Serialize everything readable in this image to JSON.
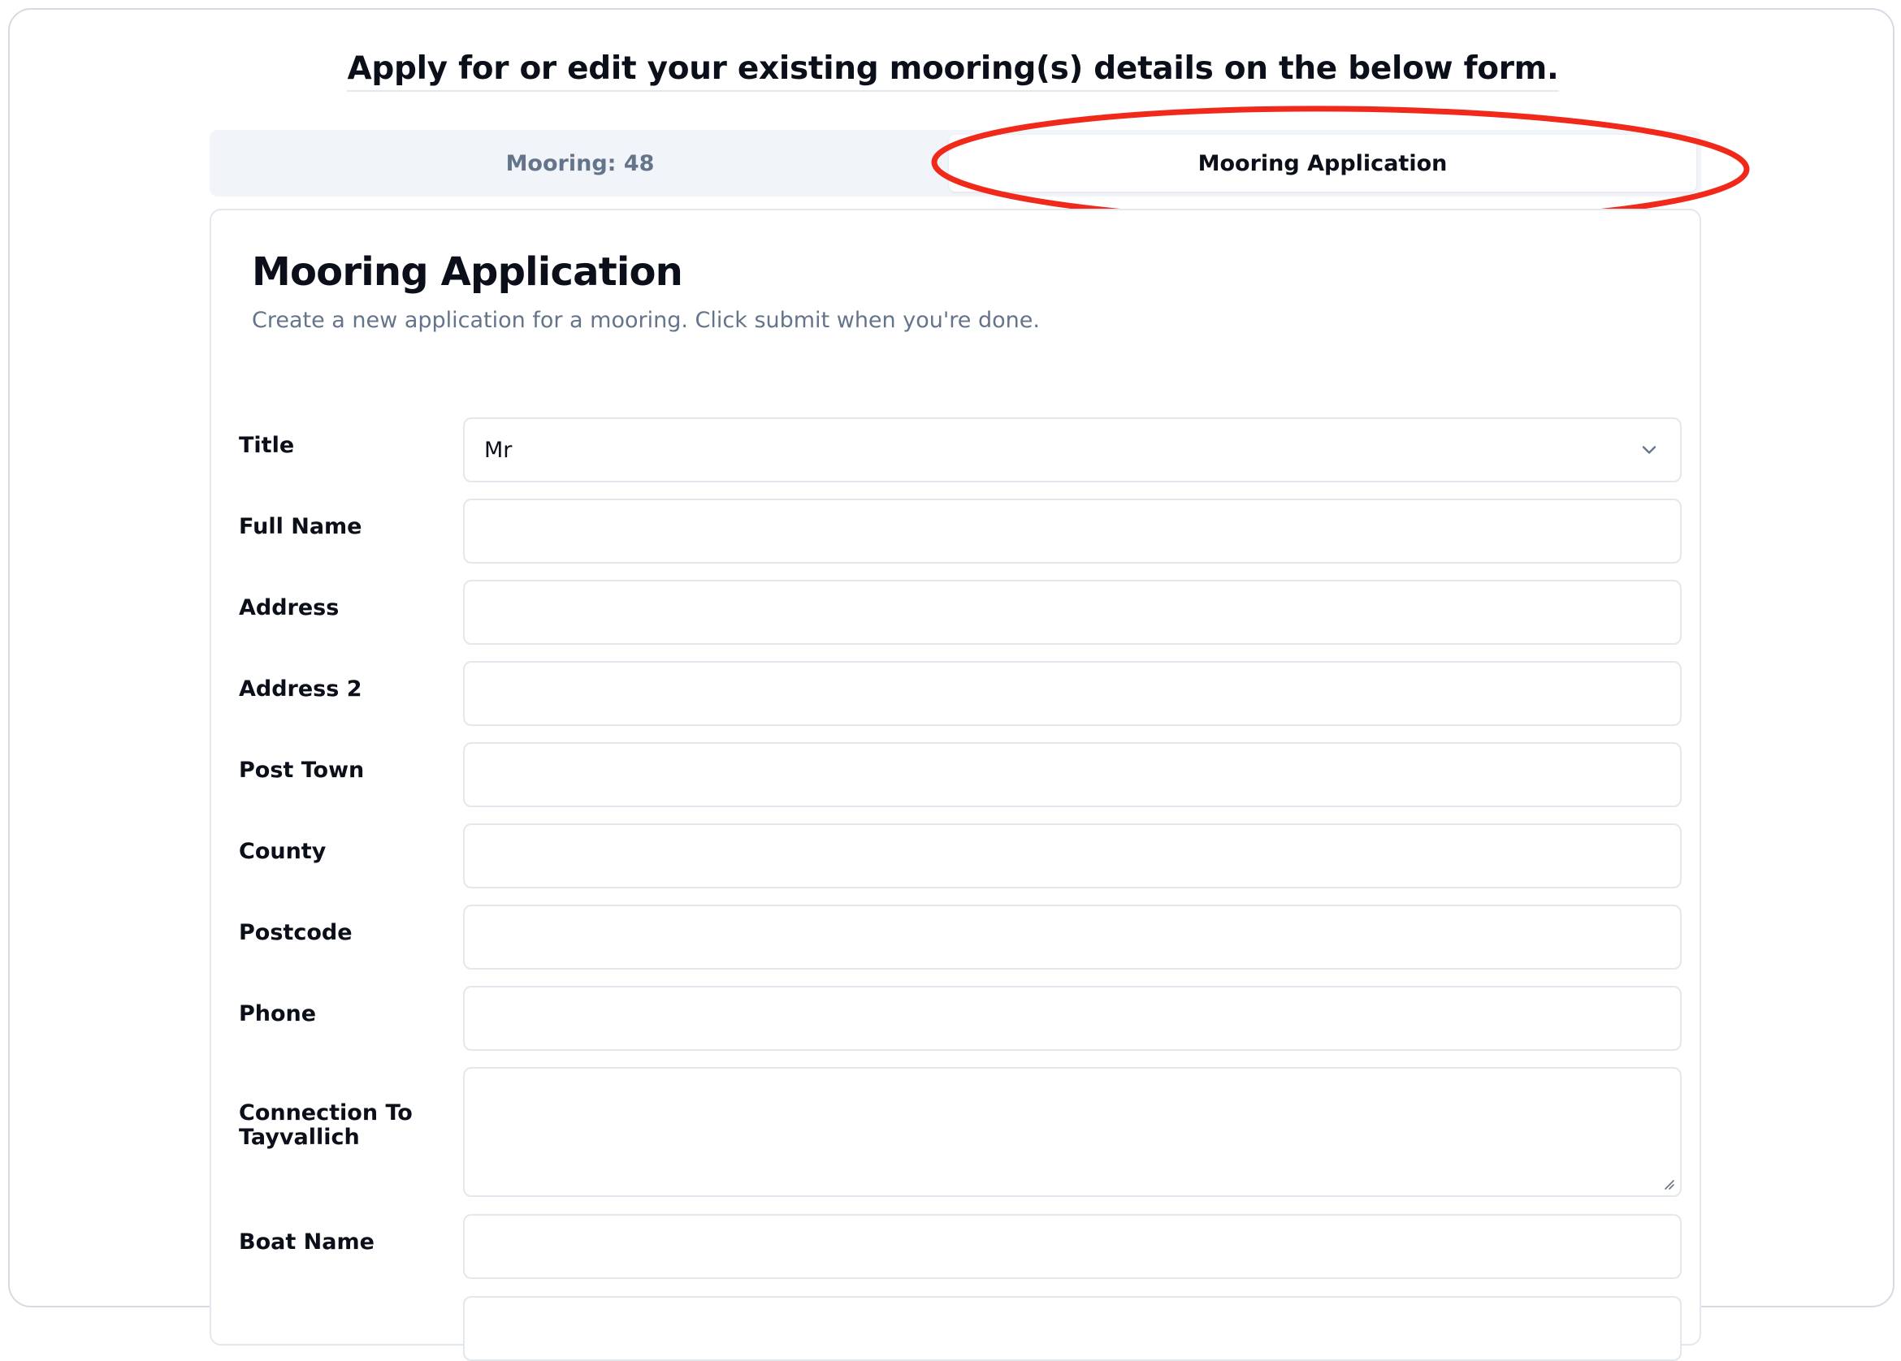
{
  "page": {
    "headline": "Apply for or edit your existing mooring(s) details on the below form."
  },
  "tabs": [
    {
      "label": "Mooring: 48",
      "active": false
    },
    {
      "label": "Mooring Application",
      "active": true
    }
  ],
  "card": {
    "title": "Mooring Application",
    "description": "Create a new application for a mooring. Click submit when you're done."
  },
  "form": {
    "title": {
      "label": "Title",
      "value": "Mr"
    },
    "full_name": {
      "label": "Full Name",
      "value": ""
    },
    "address": {
      "label": "Address",
      "value": ""
    },
    "address2": {
      "label": "Address 2",
      "value": ""
    },
    "post_town": {
      "label": "Post Town",
      "value": ""
    },
    "county": {
      "label": "County",
      "value": ""
    },
    "postcode": {
      "label": "Postcode",
      "value": ""
    },
    "phone": {
      "label": "Phone",
      "value": ""
    },
    "connection": {
      "label_line1": "Connection To",
      "label_line2": "Tayvallich",
      "value": ""
    },
    "boat_name": {
      "label": "Boat Name",
      "value": ""
    }
  },
  "colors": {
    "annotation": "#f0291a",
    "muted_text": "#64748b",
    "border": "#e3e7ee"
  }
}
